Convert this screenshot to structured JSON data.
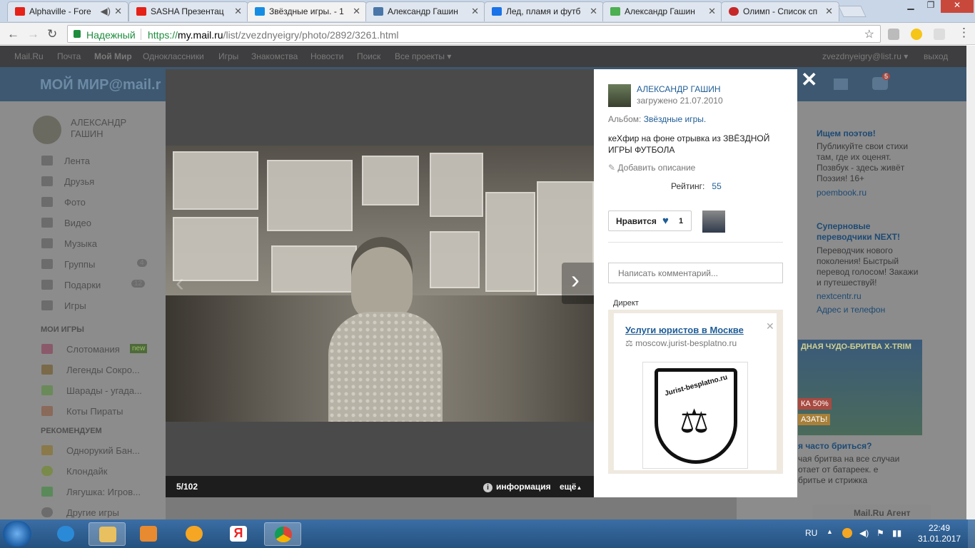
{
  "browser": {
    "tabs": [
      {
        "title": "Alphaville - Fore",
        "favicon_color": "#e62117"
      },
      {
        "title": "SASHA Презентац",
        "favicon_color": "#e62117"
      },
      {
        "title": "Звёздные игры. - 1",
        "favicon_color": "#168de2"
      },
      {
        "title": "Александр Гашин",
        "favicon_color": "#4a76a8"
      },
      {
        "title": "Лед, пламя и футб",
        "favicon_color": "#1a73e8"
      },
      {
        "title": "Александр Гашин",
        "favicon_color": "#4caf50"
      },
      {
        "title": "Олимп - Список сп",
        "favicon_color": "#c62828"
      }
    ],
    "secure_label": "Надежный",
    "url_scheme": "https://",
    "url_host": "my.mail.ru",
    "url_path": "/list/zvezdnyeigry/photo/2892/3261.html"
  },
  "portal_bar": {
    "links": [
      "Mail.Ru",
      "Почта",
      "Мой Мир",
      "Одноклассники",
      "Игры",
      "Знакомства",
      "Новости",
      "Поиск",
      "Все проекты ▾"
    ],
    "user_email": "zvezdnyeigry@list.ru ▾",
    "logout": "выход"
  },
  "header": {
    "logo": "МОЙ МИР@mail.r",
    "notification_count": "5"
  },
  "sidebar": {
    "user_name": "АЛЕКСАНДР ГАШИН",
    "items": [
      "Лента",
      "Друзья",
      "Фото",
      "Видео",
      "Музыка",
      "Группы",
      "Подарки",
      "Игры"
    ],
    "groups_count": "4",
    "gifts_count": "12",
    "my_games_title": "МОИ ИГРЫ",
    "games": [
      "Слотомания",
      "Легенды Сокро...",
      "Шарады - угада...",
      "Коты Пираты"
    ],
    "new_badge": "new",
    "recommend_title": "РЕКОМЕНДУЕМ",
    "recommended": [
      "Однорукий Бан...",
      "Клондайк",
      "Лягушка: Игров...",
      "Другие игры"
    ]
  },
  "right_ads": {
    "ad1_title": "Ищем поэтов!",
    "ad1_text": "Публикуйте свои стихи там, где их оценят. Позвбук - здесь живёт Поэзия! 16+",
    "ad1_link": "poembook.ru",
    "ad2_title": "Суперновые переводчики NEXT!",
    "ad2_text": "Переводчик нового поколения! Быстрый перевод голосом! Закажи и путешествуй!",
    "ad2_link": "nextcentr.ru",
    "ad2_addr": "Адрес и телефон",
    "ad3_banner": "ДНАЯ ЧУДО-БРИТВА X-TRIM",
    "ad3_discount": "КА 50%",
    "ad3_button": "АЗАТЬ!",
    "ad3_title": "я часто бриться?",
    "ad3_text": "чая бритва на все случаи отает от батареек. е бритье и стрижка",
    "agent": "Mail.Ru Агент"
  },
  "viewer": {
    "counter": "5/102",
    "info_label": "информация",
    "more_label": "ещё"
  },
  "panel": {
    "author": "АЛЕКСАНДР ГАШИН",
    "uploaded": "загружено 21.07.2010",
    "album_label": "Альбом:",
    "album_name": "Звёздные игры.",
    "description": "кеХфир на фоне отрывка из ЗВЁЗДНОЙ ИГРЫ ФУТБОЛА",
    "add_description": "Добавить описание",
    "rating_label": "Рейтинг:",
    "rating_value": "55",
    "like_label": "Нравится",
    "like_count": "1",
    "comment_placeholder": "Написать комментарий...",
    "direct_label": "Директ",
    "ad_title": "Услуги юристов в Москве",
    "ad_url": "moscow.jurist-besplatno.ru",
    "ad_logo_text": "Jurist-besplatno.ru"
  },
  "taskbar": {
    "lang": "RU",
    "time": "22:49",
    "date": "31.01.2017"
  }
}
